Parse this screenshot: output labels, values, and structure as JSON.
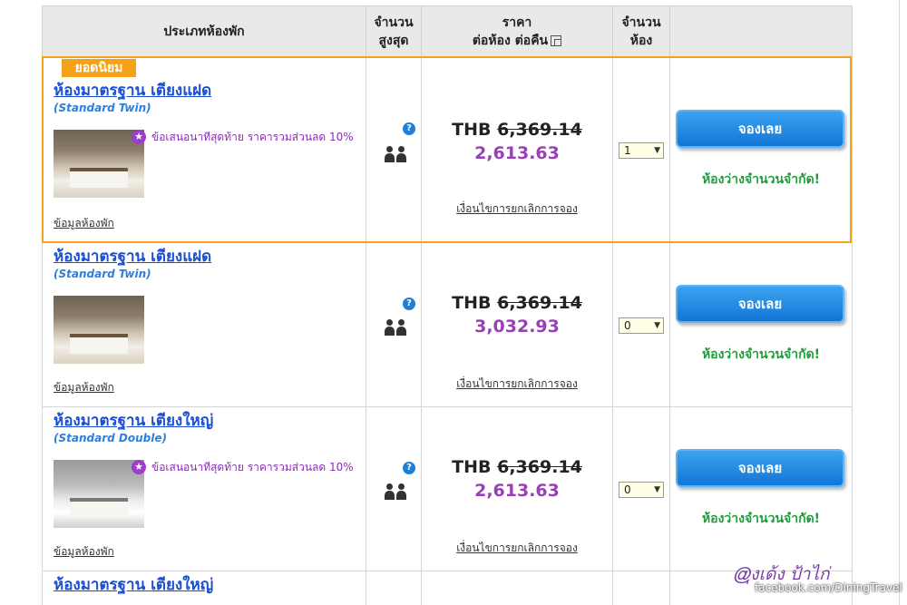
{
  "header": {
    "col_type": "ประเภทห้องพัก",
    "col_max_line1": "จำนวน",
    "col_max_line2": "สูงสุด",
    "col_price_line1": "ราคา",
    "col_price_line2": "ต่อห้อง ต่อคืน",
    "col_qty_line1": "จำนวน",
    "col_qty_line2": "ห้อง"
  },
  "popular_label": "ยอดนิยม",
  "rooms": [
    {
      "name": "ห้องมาตรฐาน เตียงแฝด",
      "sub": "(Standard Twin)",
      "promo": "ข้อเสนอนาทีสุดท้าย ราคารวมส่วนลด 10%",
      "info_link": "ข้อมูลห้องพัก",
      "currency": "THB",
      "original_price": "6,369.14",
      "price": "2,613.63",
      "cancel_link": "เงื่อนไขการยกเลิกการจอง",
      "qty": "1",
      "book_label": "จองเลย",
      "availability": "ห้องว่างจำนวนจำกัด!"
    },
    {
      "name": "ห้องมาตรฐาน เตียงแฝด",
      "sub": "(Standard Twin)",
      "promo": "",
      "info_link": "ข้อมูลห้องพัก",
      "currency": "THB",
      "original_price": "6,369.14",
      "price": "3,032.93",
      "cancel_link": "เงื่อนไขการยกเลิกการจอง",
      "qty": "0",
      "book_label": "จองเลย",
      "availability": "ห้องว่างจำนวนจำกัด!"
    },
    {
      "name": "ห้องมาตรฐาน เตียงใหญ่",
      "sub": "(Standard Double)",
      "promo": "ข้อเสนอนาทีสุดท้าย ราคารวมส่วนลด 10%",
      "info_link": "ข้อมูลห้องพัก",
      "currency": "THB",
      "original_price": "6,369.14",
      "price": "2,613.63",
      "cancel_link": "เงื่อนไขการยกเลิกการจอง",
      "qty": "0",
      "book_label": "จองเลย",
      "availability": "ห้องว่างจำนวนจำกัด!"
    },
    {
      "name": "ห้องมาตรฐาน เตียงใหญ่"
    }
  ],
  "watermark": {
    "signature": "@ุงเด้ง ป้าไก่",
    "url": "facebook.com/DiningTravel"
  },
  "colors": {
    "accent_orange": "#f5a21a",
    "link_blue": "#1a4fd0",
    "price_purple": "#9b3fb8",
    "button_blue": "#1176d6",
    "availability_green": "#1e9e3a"
  },
  "icons": {
    "promo": "star-badge-icon",
    "help": "question-icon",
    "occupancy": "two-people-icon",
    "popup": "popup-window-icon"
  }
}
